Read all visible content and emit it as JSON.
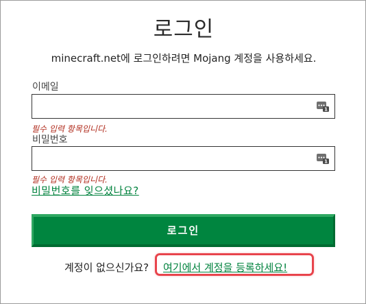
{
  "title": "로그인",
  "subtitle": "minecraft.net에 로그인하려면 Mojang 계정을 사용하세요.",
  "email": {
    "label": "이메일",
    "value": "",
    "error": "필수 입력 항목입니다."
  },
  "password": {
    "label": "비밀번호",
    "value": "",
    "error": "필수 입력 항목입니다."
  },
  "forgot_password": "비밀번호를 잊으셨나요?",
  "login_button": "로그인",
  "no_account": "계정이 없으신가요?",
  "register_link": "여기에서 계정을 등록하세요!",
  "icons": {
    "field_icon": "password-manager-icon"
  },
  "colors": {
    "accent": "#00853f",
    "link": "#00823d",
    "error": "#b02b1c",
    "highlight": "#e8444c"
  }
}
